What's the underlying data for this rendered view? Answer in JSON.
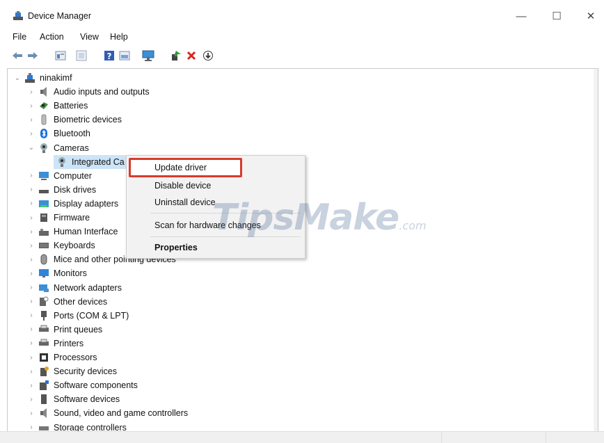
{
  "window": {
    "title": "Device Manager",
    "minimize_glyph": "—",
    "maximize_glyph": "☐",
    "close_glyph": "✕"
  },
  "menu": [
    "File",
    "Action",
    "View",
    "Help"
  ],
  "toolbar_icons": [
    "back-arrow-icon",
    "forward-arrow-icon",
    "properties-icon",
    "show-hidden-icon",
    "help-icon",
    "view-icon",
    "monitor-icon",
    "update-driver-icon",
    "uninstall-x-icon",
    "download-icon"
  ],
  "tree": {
    "root": "ninakimf",
    "categories": [
      {
        "label": "Audio inputs and outputs",
        "icon": "speaker-icon",
        "expanded": false
      },
      {
        "label": "Batteries",
        "icon": "battery-icon",
        "expanded": false
      },
      {
        "label": "Biometric devices",
        "icon": "biometric-icon",
        "expanded": false
      },
      {
        "label": "Bluetooth",
        "icon": "bluetooth-icon",
        "expanded": false
      },
      {
        "label": "Cameras",
        "icon": "camera-icon",
        "expanded": true
      },
      {
        "label": "Integrated Ca",
        "icon": "camera-icon",
        "child": true
      },
      {
        "label": "Computer",
        "icon": "computer-icon",
        "expanded": false
      },
      {
        "label": "Disk drives",
        "icon": "disk-icon",
        "expanded": false
      },
      {
        "label": "Display adapters",
        "icon": "display-adapter-icon",
        "expanded": false
      },
      {
        "label": "Firmware",
        "icon": "firmware-icon",
        "expanded": false
      },
      {
        "label": "Human Interface",
        "icon": "hid-icon",
        "expanded": false
      },
      {
        "label": "Keyboards",
        "icon": "keyboard-icon",
        "expanded": false
      },
      {
        "label": "Mice and other pointing devices",
        "icon": "mouse-icon",
        "expanded": false
      },
      {
        "label": "Monitors",
        "icon": "monitor-icon",
        "expanded": false
      },
      {
        "label": "Network adapters",
        "icon": "network-icon",
        "expanded": false
      },
      {
        "label": "Other devices",
        "icon": "other-device-icon",
        "expanded": false
      },
      {
        "label": "Ports (COM & LPT)",
        "icon": "port-icon",
        "expanded": false
      },
      {
        "label": "Print queues",
        "icon": "printer-icon",
        "expanded": false
      },
      {
        "label": "Printers",
        "icon": "printer-icon",
        "expanded": false
      },
      {
        "label": "Processors",
        "icon": "processor-icon",
        "expanded": false
      },
      {
        "label": "Security devices",
        "icon": "security-icon",
        "expanded": false
      },
      {
        "label": "Software components",
        "icon": "software-component-icon",
        "expanded": false
      },
      {
        "label": "Software devices",
        "icon": "software-device-icon",
        "expanded": false
      },
      {
        "label": "Sound, video and game controllers",
        "icon": "speaker-icon",
        "expanded": false
      },
      {
        "label": "Storage controllers",
        "icon": "storage-icon",
        "expanded": false
      }
    ]
  },
  "context_menu": {
    "items": [
      "Update driver",
      "Disable device",
      "Uninstall device",
      "Scan for hardware changes",
      "Properties"
    ],
    "highlighted": "Update driver",
    "highlight_color": "#d83a2b"
  },
  "watermark": {
    "main": "TipsMake",
    "suffix": ".com"
  }
}
